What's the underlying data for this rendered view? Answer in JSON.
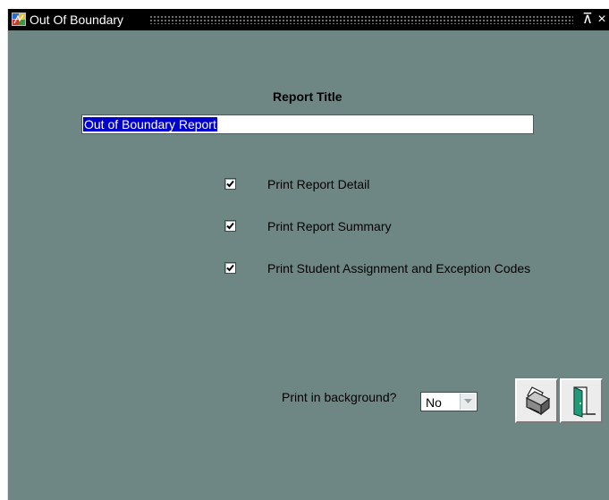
{
  "window": {
    "title": "Out Of Boundary",
    "restore_glyph": "⊼",
    "close_glyph": "×"
  },
  "form": {
    "report_title_label": "Report Title",
    "report_title_value": "Out of Boundary Report",
    "checkboxes": [
      {
        "label": "Print Report Detail",
        "checked": true
      },
      {
        "label": "Print Report Summary",
        "checked": true
      },
      {
        "label": "Print Student Assignment and Exception Codes",
        "checked": true
      }
    ],
    "background_label": "Print in background?",
    "background_value": "No"
  },
  "icons": {
    "app": "app-icon",
    "print": "printer-icon",
    "exit": "exit-door-icon"
  }
}
